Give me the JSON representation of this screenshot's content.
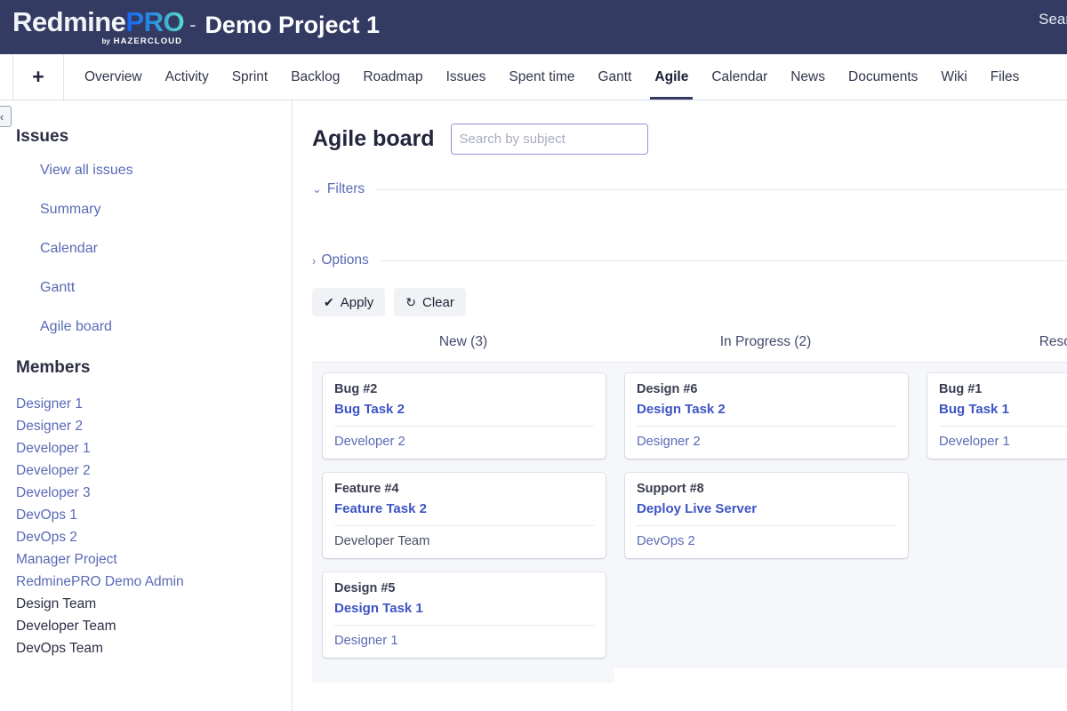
{
  "header": {
    "logo_main_1": "Redmine",
    "logo_main_2": "PRO",
    "logo_dash": "-",
    "logo_sub_by": "by",
    "logo_sub_brand": "HAZERCLOUD",
    "project_title": "Demo Project 1",
    "search_label": "Search",
    "bg_color": "#333b63"
  },
  "nav": {
    "add_label": "+",
    "tabs": [
      {
        "label": "Overview",
        "active": false
      },
      {
        "label": "Activity",
        "active": false
      },
      {
        "label": "Sprint",
        "active": false
      },
      {
        "label": "Backlog",
        "active": false
      },
      {
        "label": "Roadmap",
        "active": false
      },
      {
        "label": "Issues",
        "active": false
      },
      {
        "label": "Spent time",
        "active": false
      },
      {
        "label": "Gantt",
        "active": false
      },
      {
        "label": "Agile",
        "active": true
      },
      {
        "label": "Calendar",
        "active": false
      },
      {
        "label": "News",
        "active": false
      },
      {
        "label": "Documents",
        "active": false
      },
      {
        "label": "Wiki",
        "active": false
      },
      {
        "label": "Files",
        "active": false
      }
    ]
  },
  "sidebar": {
    "collapse_icon": "‹",
    "issues_heading": "Issues",
    "issue_links": [
      {
        "label": "View all issues"
      },
      {
        "label": "Summary"
      },
      {
        "label": "Calendar"
      },
      {
        "label": "Gantt"
      },
      {
        "label": "Agile board"
      }
    ],
    "members_heading": "Members",
    "members": [
      {
        "label": "Designer 1",
        "is_link": true
      },
      {
        "label": "Designer 2",
        "is_link": true
      },
      {
        "label": "Developer 1",
        "is_link": true
      },
      {
        "label": "Developer 2",
        "is_link": true
      },
      {
        "label": "Developer 3",
        "is_link": true
      },
      {
        "label": "DevOps 1",
        "is_link": true
      },
      {
        "label": "DevOps 2",
        "is_link": true
      },
      {
        "label": "Manager Project",
        "is_link": true
      },
      {
        "label": "RedminePRO Demo Admin",
        "is_link": true
      },
      {
        "label": "Design Team",
        "is_link": false
      },
      {
        "label": "Developer Team",
        "is_link": false
      },
      {
        "label": "DevOps Team",
        "is_link": false
      }
    ]
  },
  "main": {
    "page_title": "Agile board",
    "search": {
      "value": "",
      "placeholder": "Search by subject"
    },
    "filters_label": "Filters",
    "filters_chevron": "⌄",
    "options_label": "Options",
    "options_chevron": "›",
    "apply_label": "Apply",
    "apply_icon": "✔",
    "clear_label": "Clear",
    "clear_icon": "↻"
  },
  "board": {
    "columns": [
      {
        "header": "New (3)",
        "cards": [
          {
            "type": "Bug #2",
            "subject": "Bug Task 2",
            "assignee": "Developer 2",
            "assignee_is_link": true
          },
          {
            "type": "Feature #4",
            "subject": "Feature Task 2",
            "assignee": "Developer Team",
            "assignee_is_link": false
          },
          {
            "type": "Design #5",
            "subject": "Design Task 1",
            "assignee": "Designer 1",
            "assignee_is_link": true
          }
        ]
      },
      {
        "header": "In Progress (2)",
        "cards": [
          {
            "type": "Design #6",
            "subject": "Design Task 2",
            "assignee": "Designer 2",
            "assignee_is_link": true
          },
          {
            "type": "Support #8",
            "subject": "Deploy Live Server",
            "assignee": "DevOps 2",
            "assignee_is_link": true
          }
        ]
      },
      {
        "header": "Resolved",
        "cards": [
          {
            "type": "Bug #1",
            "subject": "Bug Task 1",
            "assignee": "Developer 1",
            "assignee_is_link": true
          }
        ]
      }
    ]
  }
}
